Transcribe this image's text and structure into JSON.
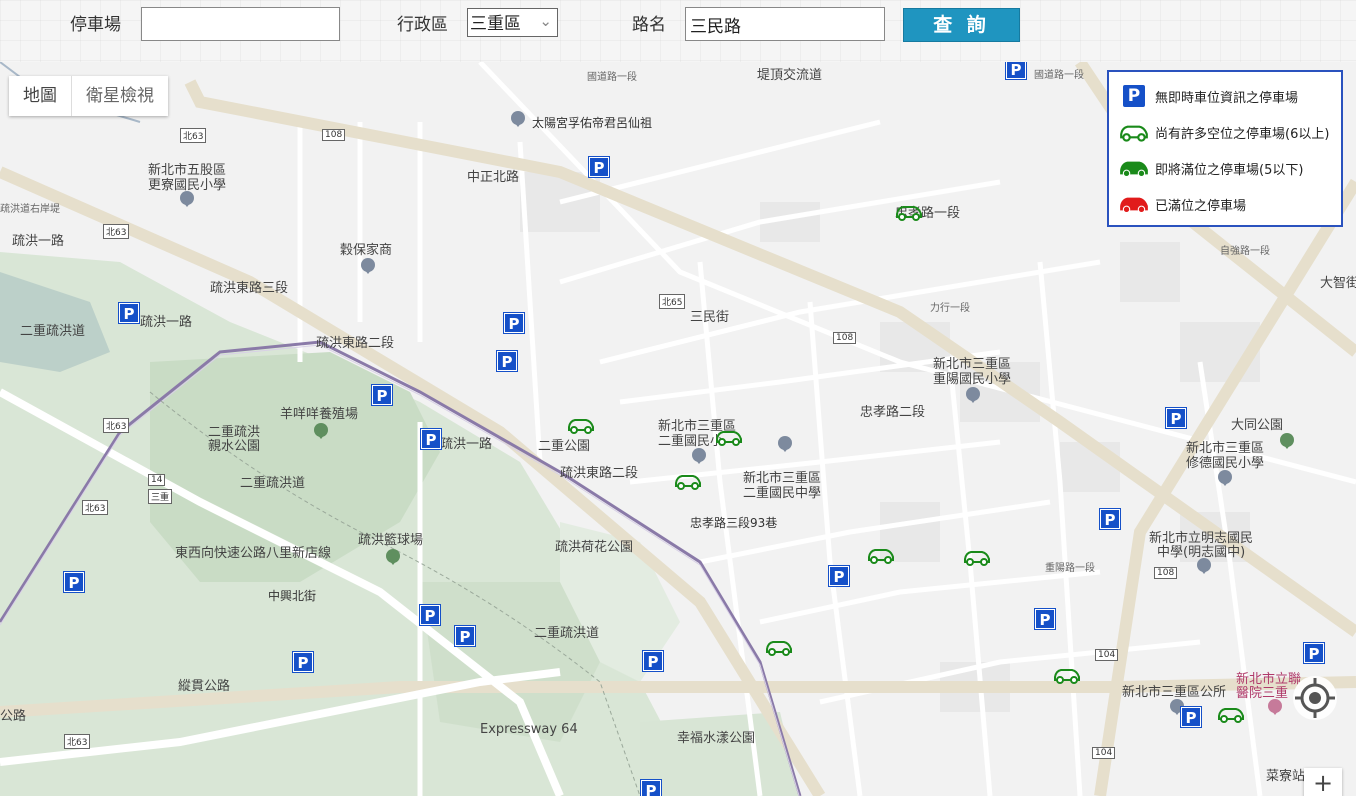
{
  "toolbar": {
    "parking_label": "停車場",
    "parking_value": "",
    "district_label": "行政區",
    "district_value": "三重區",
    "road_label": "路名",
    "road_value": "三民路",
    "search_button": "查 詢"
  },
  "map_type": {
    "map": "地圖",
    "satellite": "衛星檢視"
  },
  "legend": {
    "items": [
      {
        "icon": "parking-icon",
        "text": "無即時車位資訊之停車場"
      },
      {
        "icon": "car-outline-green-icon",
        "text": "尚有許多空位之停車場(6以上)"
      },
      {
        "icon": "car-filled-green-icon",
        "text": "即將滿位之停車場(5以下)"
      },
      {
        "icon": "car-filled-red-icon",
        "text": "已滿位之停車場"
      }
    ]
  },
  "colors": {
    "parking_blue": "#1550c8",
    "car_green": "#1a8a1a",
    "car_red": "#e11b1b",
    "button_blue": "#1f95c0",
    "legend_border": "#2a52be"
  },
  "map_labels": {
    "l1": "堤頂交流道",
    "l2": "國道路一段",
    "l3": "國道路一段",
    "l4": "太陽宮孚佑帝君呂仙祖",
    "l5": "中正北路",
    "l6": "新北市五股區",
    "l7": "更寮國民小學",
    "l8": "疏洪道右岸堤",
    "l9": "疏洪一路",
    "l10": "穀保家商",
    "l11": "疏洪東路三段",
    "l12": "二重疏洪道",
    "l13": "疏洪一路",
    "l14": "疏洪東路二段",
    "l15": "羊咩咩養殖場",
    "l16": "二重疏洪",
    "l17": "親水公園",
    "l18": "二重疏洪道",
    "l19": "東西向快速公路八里新店線",
    "l20": "疏洪籃球場",
    "l21": "二重公園",
    "l22": "新北市三重區",
    "l23": "二重國民小",
    "l24": "新北市三重區",
    "l25": "二重國民中學",
    "l26": "疏洪東路二段",
    "l27": "忠孝路三段93巷",
    "l28": "疏洪荷花公園",
    "l29": "三民街",
    "l30": "新北市三重區",
    "l31": "重陽國民小學",
    "l32": "大同公園",
    "l33": "新北市三重區",
    "l34": "修德國民小學",
    "l35": "新北市立明志國民",
    "l36": "中學(明志國中)",
    "l37": "縱貫公路",
    "l38": "幸福水漾公園",
    "l39": "新北市三重區公所",
    "l40": "新北市立聯",
    "l41": "醫院三重",
    "l42": "忠孝路一段",
    "l43": "自強路一段",
    "l44": "大智街",
    "l45": "二重疏洪道",
    "l46": "菜寮站",
    "l47": "公路",
    "l48": "疏洪一路",
    "l49": "中興北街",
    "l50": "忠孝路二段",
    "l51": "Expressway 64",
    "l52": "力行一段",
    "l53": "重陽路一段"
  },
  "route_shields": [
    "北63",
    "108",
    "北65",
    "108",
    "北63",
    "北63",
    "北63",
    "14",
    "三重",
    "108",
    "104",
    "104",
    "北63"
  ]
}
